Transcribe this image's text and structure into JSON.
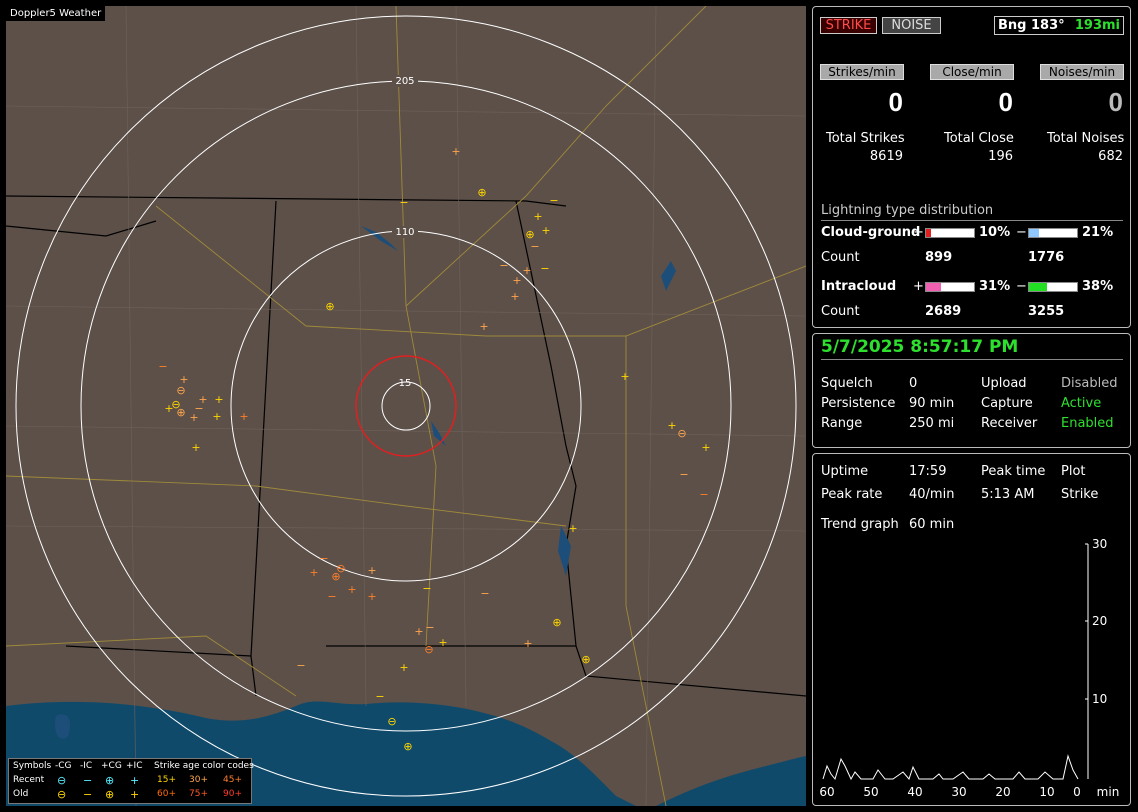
{
  "app": {
    "title": "Doppler5 Weather"
  },
  "map": {
    "ring_labels": [
      "205",
      "110",
      "15"
    ],
    "strike_icons": [
      "plus-marker",
      "minus-marker",
      "circle-plus-marker",
      "circle-minus-marker"
    ]
  },
  "legend": {
    "symbols_label": "Symbols",
    "col_labels": [
      "-CG",
      "-IC",
      "+CG",
      "+IC"
    ],
    "age_title": "Strike age color codes",
    "recent_label": "Recent",
    "old_label": "Old",
    "age_codes_recent": [
      "15+",
      "30+",
      "45+"
    ],
    "age_codes_old": [
      "60+",
      "75+",
      "90+"
    ],
    "age_colors": [
      "#ffd700",
      "#ffa64d",
      "#ff7f2a",
      "#ff6a00",
      "#ff5a2a",
      "#ff3c2a"
    ],
    "symbol_glyphs": [
      "⊖",
      "−",
      "⊕",
      "+"
    ]
  },
  "top_panel": {
    "strike_btn": "STRIKE",
    "noise_btn": "NOISE",
    "bearing_label": "Bng 183°",
    "distance": "193mi",
    "rate_labels": [
      "Strikes/min",
      "Close/min",
      "Noises/min"
    ],
    "rate_values": [
      "0",
      "0",
      "0"
    ],
    "total_labels": [
      "Total Strikes",
      "Total Close",
      "Total Noises"
    ],
    "total_values": [
      "8619",
      "196",
      "682"
    ],
    "dist_title": "Lightning type distribution",
    "cg_label": "Cloud-ground",
    "ic_label": "Intracloud",
    "count_label": "Count",
    "plus_sign": "+",
    "minus_sign": "−",
    "cg_pos_pct": "10%",
    "cg_neg_pct": "21%",
    "ic_pos_pct": "31%",
    "ic_neg_pct": "38%",
    "cg_pos_count": "899",
    "cg_neg_count": "1776",
    "ic_pos_count": "2689",
    "ic_neg_count": "3255",
    "bar_fractions": {
      "cg_pos": 0.1,
      "cg_neg": 0.21,
      "ic_pos": 0.31,
      "ic_neg": 0.38
    },
    "bar_colors": {
      "cg_pos": "#e02020",
      "cg_neg": "#8ec8ff",
      "ic_pos": "#f060b0",
      "ic_neg": "#22e022"
    }
  },
  "status_panel": {
    "datetime": "5/7/2025 8:57:17 PM",
    "rows": [
      {
        "label": "Squelch",
        "value": "0",
        "label2": "Upload",
        "value2": "Disabled"
      },
      {
        "label": "Persistence",
        "value": "90 min",
        "label2": "Capture",
        "value2": "Active"
      },
      {
        "label": "Range",
        "value": "250 mi",
        "label2": "Receiver",
        "value2": "Enabled"
      }
    ]
  },
  "stats_panel": {
    "uptime_label": "Uptime",
    "uptime": "17:59",
    "peak_time_label": "Peak time",
    "peak_time": "5:13 AM",
    "plot_label": "Plot",
    "plot_value": "Strike",
    "peak_rate_label": "Peak rate",
    "peak_rate": "40/min",
    "trend_label": "Trend graph",
    "trend_value": "60 min"
  },
  "chart_data": {
    "type": "line",
    "x_tick_labels": [
      "60",
      "50",
      "40",
      "30",
      "20",
      "10",
      "0"
    ],
    "x_unit": "min",
    "y_tick_labels": [
      "30",
      "20",
      "10"
    ],
    "ylim": [
      0,
      30
    ],
    "xlim": [
      60,
      0
    ]
  }
}
